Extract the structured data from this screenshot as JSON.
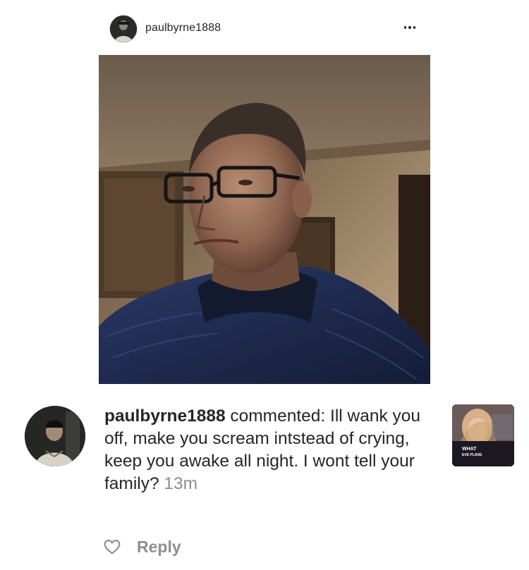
{
  "post": {
    "username": "paulbyrne1888",
    "more_icon": "more-horizontal-icon",
    "photo_description": "selfie-photo"
  },
  "comment": {
    "username": "paulbyrne1888",
    "text": " commented: Ill wank you off, make you scream intstead of crying, keep you awake all night. I wont tell your family? ",
    "time": "13m",
    "thumb_text": [
      "WHAT",
      "EVE PLANS"
    ]
  },
  "actions": {
    "reply_label": "Reply",
    "like_icon": "heart-outline-icon"
  },
  "colors": {
    "text": "#262626",
    "muted": "#8e8e8e",
    "background": "#ffffff"
  }
}
